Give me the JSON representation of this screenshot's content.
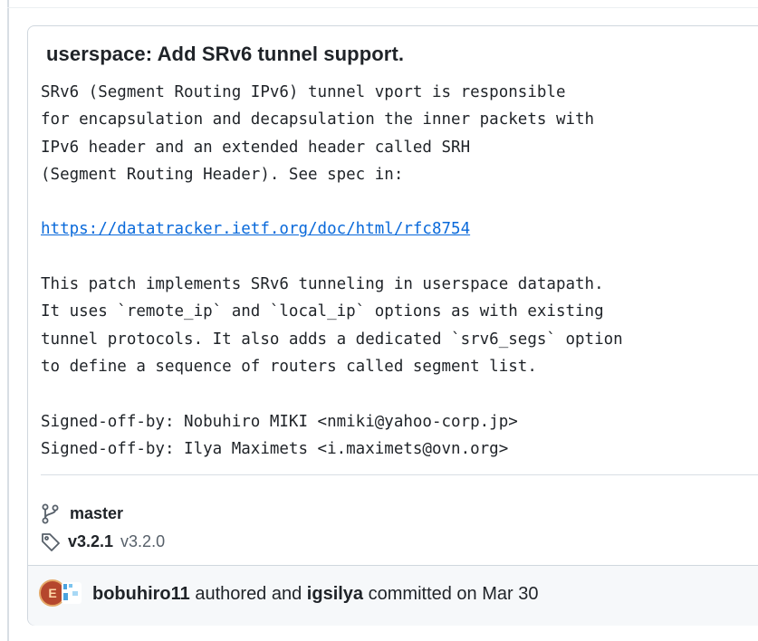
{
  "commit": {
    "title": "userspace: Add SRv6 tunnel support.",
    "body_lines_1": [
      "SRv6 (Segment Routing IPv6) tunnel vport is responsible",
      "for encapsulation and decapsulation the inner packets with",
      "IPv6 header and an extended header called SRH",
      "(Segment Routing Header). See spec in:"
    ],
    "spec_link": "https://datatracker.ietf.org/doc/html/rfc8754",
    "body_lines_2": [
      "This patch implements SRv6 tunneling in userspace datapath.",
      "It uses `remote_ip` and `local_ip` options as with existing",
      "tunnel protocols. It also adds a dedicated `srv6_segs` option",
      "to define a sequence of routers called segment list."
    ],
    "signoffs": [
      "Signed-off-by: Nobuhiro MIKI <nmiki@yahoo-corp.jp>",
      "Signed-off-by: Ilya Maximets <i.maximets@ovn.org>"
    ]
  },
  "refs": {
    "branch_icon": "git-branch-icon",
    "branch": "master",
    "tag_icon": "tag-icon",
    "tag_primary": "v3.2.1",
    "tag_secondary": "v3.2.0"
  },
  "footer": {
    "author": "bobuhiro11",
    "authored_text": " authored and ",
    "committer": "igsilya",
    "committed_text": " committed on Mar 30"
  },
  "colors": {
    "link": "#0969da",
    "border": "#d0d7de",
    "text": "#1f2328",
    "muted": "#57606a"
  }
}
